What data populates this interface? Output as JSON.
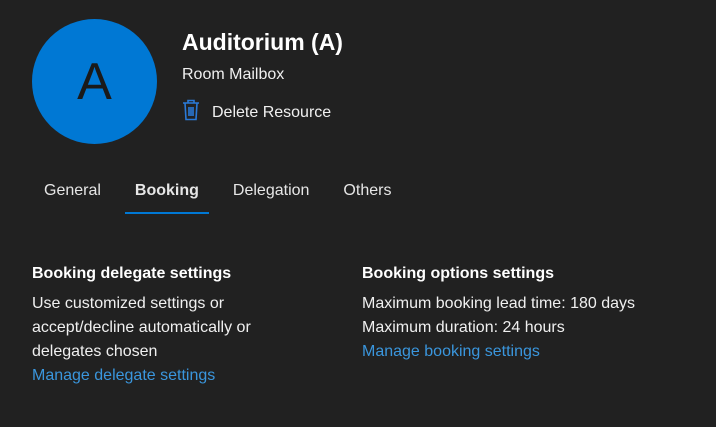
{
  "header": {
    "avatar_initial": "A",
    "title": "Auditorium (A)",
    "subtitle": "Room Mailbox",
    "delete_label": "Delete Resource"
  },
  "tabs": [
    {
      "label": "General"
    },
    {
      "label": "Booking",
      "active": true
    },
    {
      "label": "Delegation"
    },
    {
      "label": "Others"
    }
  ],
  "delegate": {
    "heading": "Booking delegate settings",
    "lines": [
      "Use customized settings or",
      "accept/decline automatically or",
      "delegates chosen"
    ],
    "link": "Manage delegate settings"
  },
  "options": {
    "heading": "Booking options settings",
    "lines": [
      "Maximum booking lead time: 180 days",
      "Maximum duration: 24 hours"
    ],
    "link": "Manage booking settings"
  },
  "colors": {
    "accent": "#0078d4",
    "background": "#212121",
    "link": "#3a96dd"
  }
}
